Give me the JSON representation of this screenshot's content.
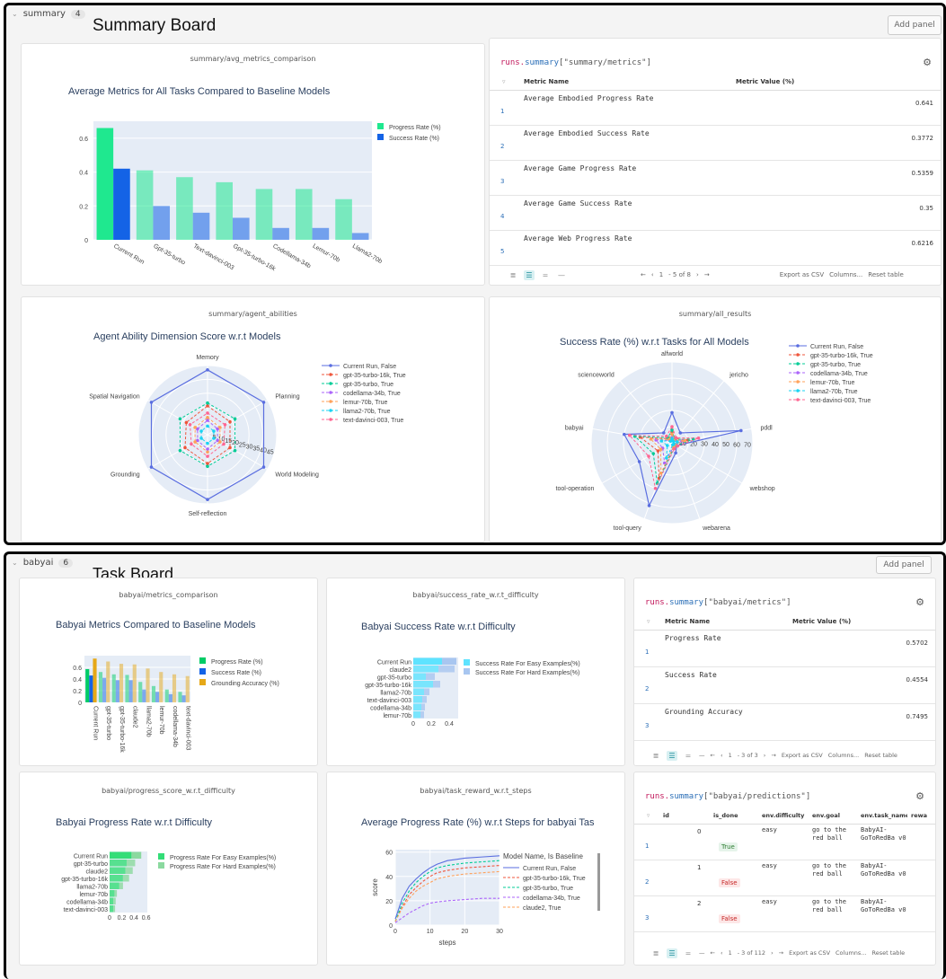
{
  "summary_board": {
    "section_name": "summary",
    "section_count": "4",
    "board_title": "Summary Board",
    "add_panel": "Add panel",
    "avg_panel": {
      "panel_title": "summary/avg_metrics_comparison",
      "chart_title": "Average Metrics for All Tasks Compared to Baseline Models"
    },
    "metrics_table": {
      "code_runs": "runs.",
      "code_summary": "summary",
      "code_key": "[\"summary/metrics\"]",
      "col_metric": "Metric Name",
      "col_value": "Metric Value (%)",
      "rows": [
        {
          "n": "1",
          "name": "Average Embodied Progress Rate",
          "value": "0.641"
        },
        {
          "n": "2",
          "name": "Average Embodied Success Rate",
          "value": "0.3772"
        },
        {
          "n": "3",
          "name": "Average Game Progress Rate",
          "value": "0.5359"
        },
        {
          "n": "4",
          "name": "Average Game Success Rate",
          "value": "0.35"
        },
        {
          "n": "5",
          "name": "Average Web Progress Rate",
          "value": "0.6216"
        }
      ],
      "page_num": "1",
      "page_info": "- 5 of 8",
      "export": "Export as CSV",
      "columns": "Columns...",
      "reset": "Reset table"
    },
    "abilities_panel": {
      "panel_title": "summary/agent_abilities",
      "chart_title": "Agent Ability Dimension Score w.r.t Models"
    },
    "results_panel": {
      "panel_title": "summary/all_results",
      "chart_title": "Success Rate (%) w.r.t Tasks for All Models"
    }
  },
  "task_board": {
    "section_name": "babyai",
    "section_count": "6",
    "board_title": "Task Board",
    "add_panel": "Add panel",
    "metrics_panel": {
      "panel_title": "babyai/metrics_comparison",
      "chart_title": "Babyai Metrics Compared to Baseline Models"
    },
    "success_panel": {
      "panel_title": "babyai/success_rate_w.r.t_difficulty",
      "chart_title": "Babyai Success Rate w.r.t Difficulty"
    },
    "babyai_table": {
      "code_runs": "runs.",
      "code_summary": "summary",
      "code_key": "[\"babyai/metrics\"]",
      "col_metric": "Metric Name",
      "col_value": "Metric Value (%)",
      "rows": [
        {
          "n": "1",
          "name": "Progress Rate",
          "value": "0.5702"
        },
        {
          "n": "2",
          "name": "Success Rate",
          "value": "0.4554"
        },
        {
          "n": "3",
          "name": "Grounding Accuracy",
          "value": "0.7495"
        }
      ],
      "page_num": "1",
      "page_info": "- 3 of 3",
      "export": "Export as CSV",
      "columns": "Columns...",
      "reset": "Reset table"
    },
    "progress_panel": {
      "panel_title": "babyai/progress_score_w.r.t_difficulty",
      "chart_title": "Babyai Progress Rate w.r.t Difficulty"
    },
    "reward_panel": {
      "panel_title": "babyai/task_reward_w.r.t_steps",
      "chart_title": "Average Progress Rate (%) w.r.t Steps for babyai Tas"
    },
    "predictions_table": {
      "code_runs": "runs.",
      "code_summary": "summary",
      "code_key": "[\"babyai/predictions\"]",
      "cols": [
        "id",
        "is_done",
        "env.difficulty",
        "env.goal",
        "env.task_name",
        "rewa"
      ],
      "rows": [
        {
          "n": "1",
          "id": "0",
          "done": "True",
          "diff": "easy",
          "goal": "go to the red ball",
          "task": "BabyAI-GoToRedBa v0"
        },
        {
          "n": "2",
          "id": "1",
          "done": "False",
          "diff": "easy",
          "goal": "go to the red ball",
          "task": "BabyAI-GoToRedBa v0"
        },
        {
          "n": "3",
          "id": "2",
          "done": "False",
          "diff": "easy",
          "goal": "go to the red ball",
          "task": "BabyAI-GoToRedBa v0"
        }
      ],
      "page_num": "1",
      "page_info": "- 3 of 112",
      "export": "Export as CSV",
      "columns": "Columns...",
      "reset": "Reset table"
    }
  },
  "chart_data": [
    {
      "type": "bar",
      "title": "Average Metrics for All Tasks Compared to Baseline Models",
      "categories": [
        "Current Run",
        "Gpt-35-turbo",
        "Text-davinci-003",
        "Gpt-35-turbo-16k",
        "Codellama-34b",
        "Lemur-70b",
        "Llama2-70b"
      ],
      "series": [
        {
          "name": "Progress Rate (%)",
          "values": [
            0.66,
            0.41,
            0.37,
            0.34,
            0.3,
            0.3,
            0.24
          ]
        },
        {
          "name": "Success Rate (%)",
          "values": [
            0.42,
            0.2,
            0.16,
            0.13,
            0.07,
            0.07,
            0.04
          ]
        }
      ],
      "yticks": [
        "0",
        "0.2",
        "0.4",
        "0.6"
      ],
      "ylim": [
        0,
        0.7
      ],
      "colors": [
        "#1fe88f",
        "#1463e6"
      ]
    },
    {
      "type": "radar",
      "title": "Agent Ability Dimension Score w.r.t Models",
      "axes": [
        "Memory",
        "Planning",
        "World Modeling",
        "Self-reflection",
        "Grounding",
        "Spatial Navigation"
      ],
      "radial_ticks": [
        "5",
        "10",
        "15",
        "20",
        "25",
        "30",
        "35",
        "40",
        "45"
      ],
      "rmax": 48,
      "series": [
        {
          "name": "Current Run, False",
          "color": "#5a6ee0",
          "dash": "",
          "values": [
            45,
            45,
            45,
            45,
            45,
            45
          ]
        },
        {
          "name": "gpt-35-turbo-16k, True",
          "color": "#ef553b",
          "dash": "3,2",
          "values": [
            20,
            18,
            18,
            20,
            18,
            17
          ]
        },
        {
          "name": "gpt-35-turbo, True",
          "color": "#00cc96",
          "dash": "3,2",
          "values": [
            22,
            22,
            22,
            22,
            22,
            22
          ]
        },
        {
          "name": "codellama-34b, True",
          "color": "#ab63fa",
          "dash": "3,2",
          "values": [
            10,
            8,
            8,
            10,
            8,
            8
          ]
        },
        {
          "name": "lemur-70b, True",
          "color": "#ffa15a",
          "dash": "3,2",
          "values": [
            12,
            10,
            10,
            12,
            10,
            10
          ]
        },
        {
          "name": "llama2-70b, True",
          "color": "#19d3f3",
          "dash": "3,2",
          "values": [
            6,
            5,
            5,
            6,
            5,
            5
          ]
        },
        {
          "name": "text-davinci-003, True",
          "color": "#ff6692",
          "dash": "3,2",
          "values": [
            15,
            14,
            13,
            15,
            13,
            14
          ]
        }
      ]
    },
    {
      "type": "radar",
      "title": "Success Rate (%) w.r.t Tasks for All Models",
      "axes": [
        "alfworld",
        "jericho",
        "pddl",
        "webshop",
        "webarena",
        "tool-query",
        "tool-operation",
        "babyai",
        "scienceworld"
      ],
      "radial_ticks": [
        "10",
        "20",
        "30",
        "40",
        "50",
        "60",
        "70"
      ],
      "rmax": 75,
      "series": [
        {
          "name": "Current Run, False",
          "color": "#5a6ee0",
          "dash": "",
          "values": [
            28,
            12,
            65,
            5,
            10,
            62,
            35,
            45,
            12
          ]
        },
        {
          "name": "gpt-35-turbo-16k, True",
          "color": "#ef553b",
          "dash": "3,2",
          "values": [
            10,
            5,
            15,
            5,
            5,
            35,
            15,
            30,
            5
          ]
        },
        {
          "name": "gpt-35-turbo, True",
          "color": "#00cc96",
          "dash": "3,2",
          "values": [
            12,
            4,
            20,
            5,
            5,
            40,
            20,
            35,
            6
          ]
        },
        {
          "name": "codellama-34b, True",
          "color": "#ab63fa",
          "dash": "3,2",
          "values": [
            5,
            3,
            10,
            3,
            4,
            20,
            10,
            15,
            3
          ]
        },
        {
          "name": "lemur-70b, True",
          "color": "#ffa15a",
          "dash": "3,2",
          "values": [
            8,
            3,
            12,
            3,
            4,
            30,
            12,
            20,
            4
          ]
        },
        {
          "name": "llama2-70b, True",
          "color": "#19d3f3",
          "dash": "3,2",
          "values": [
            4,
            2,
            5,
            2,
            2,
            15,
            5,
            10,
            2
          ]
        },
        {
          "name": "text-davinci-003, True",
          "color": "#ff6692",
          "dash": "3,2",
          "values": [
            15,
            6,
            25,
            6,
            6,
            45,
            25,
            40,
            8
          ]
        }
      ]
    },
    {
      "type": "bar",
      "title": "Babyai Metrics Compared to Baseline Models",
      "categories": [
        "Current Run",
        "gpt-35-turbo",
        "gpt-35-turbo-16k",
        "claude2",
        "llama2-70b",
        "lemur-70b",
        "codellama-34b",
        "text-davinci-003"
      ],
      "series": [
        {
          "name": "Progress Rate (%)",
          "values": [
            0.57,
            0.52,
            0.48,
            0.47,
            0.35,
            0.28,
            0.22,
            0.18
          ]
        },
        {
          "name": "Success Rate (%)",
          "values": [
            0.46,
            0.42,
            0.38,
            0.38,
            0.22,
            0.18,
            0.14,
            0.12
          ]
        },
        {
          "name": "Grounding Accuracy (%)",
          "values": [
            0.75,
            0.7,
            0.66,
            0.65,
            0.58,
            0.52,
            0.48,
            0.45
          ]
        }
      ],
      "yticks": [
        "0",
        "0.2",
        "0.4",
        "0.6"
      ],
      "ylim": [
        0,
        0.8
      ],
      "colors": [
        "#00cc66",
        "#1463e6",
        "#e6a817"
      ]
    },
    {
      "type": "bar",
      "title": "Babyai Success Rate w.r.t Difficulty",
      "categories": [
        "Current Run",
        "claude2",
        "gpt-35-turbo",
        "gpt-35-turbo-16k",
        "llama2-70b",
        "text-davinci-003",
        "codellama-34b",
        "lemur-70b"
      ],
      "series": [
        {
          "name": "Success Rate For Easy Examples(%)",
          "values": [
            0.32,
            0.28,
            0.14,
            0.22,
            0.12,
            0.1,
            0.09,
            0.08
          ]
        },
        {
          "name": "Success Rate For Hard Examples(%)",
          "values": [
            0.16,
            0.18,
            0.1,
            0.08,
            0.06,
            0.05,
            0.04,
            0.04
          ]
        }
      ],
      "xticks": [
        "0",
        "0.2",
        "0.4"
      ],
      "xlim": [
        0,
        0.5
      ],
      "colors": [
        "#5ee3ff",
        "#a8c6f0"
      ]
    },
    {
      "type": "bar",
      "title": "Babyai Progress Rate w.r.t Difficulty",
      "categories": [
        "Current Run",
        "gpt-35-turbo",
        "claude2",
        "gpt-35-turbo-16k",
        "llama2-70b",
        "lemur-70b",
        "codellama-34b",
        "text-davinci-003"
      ],
      "series": [
        {
          "name": "Progress Rate For Easy Examples(%)",
          "values": [
            0.36,
            0.28,
            0.26,
            0.22,
            0.16,
            0.08,
            0.06,
            0.06
          ]
        },
        {
          "name": "Progress Rate For Hard Examples(%)",
          "values": [
            0.16,
            0.14,
            0.12,
            0.1,
            0.06,
            0.04,
            0.04,
            0.03
          ]
        }
      ],
      "xticks": [
        "0",
        "0.2",
        "0.4",
        "0.6"
      ],
      "xlim": [
        0,
        0.62
      ],
      "colors": [
        "#33dd77",
        "#8bd99f"
      ]
    },
    {
      "type": "line",
      "title": "Average Progress Rate (%) w.r.t Steps for babyai Tas",
      "xlabel": "steps",
      "ylabel": "score",
      "xticks": [
        "0",
        "10",
        "20",
        "30"
      ],
      "yticks": [
        "0",
        "20",
        "40",
        "60"
      ],
      "xlim": [
        0,
        30
      ],
      "ylim": [
        0,
        62
      ],
      "legend_title": "Model Name, Is Baseline",
      "series": [
        {
          "name": "Current Run, False",
          "color": "#5a6ee0",
          "dash": "",
          "x": [
            0,
            2,
            4,
            6,
            8,
            10,
            12,
            15,
            20,
            25,
            30
          ],
          "y": [
            5,
            22,
            32,
            38,
            43,
            47,
            50,
            53,
            55,
            56,
            57
          ]
        },
        {
          "name": "gpt-35-turbo-16k, True",
          "color": "#ef553b",
          "dash": "3,2",
          "x": [
            0,
            2,
            4,
            6,
            8,
            10,
            12,
            15,
            20,
            25,
            30
          ],
          "y": [
            3,
            15,
            25,
            31,
            36,
            40,
            43,
            45,
            47,
            48,
            49
          ]
        },
        {
          "name": "gpt-35-turbo, True",
          "color": "#00cc96",
          "dash": "3,2",
          "x": [
            0,
            2,
            4,
            6,
            8,
            10,
            12,
            15,
            20,
            25,
            30
          ],
          "y": [
            3,
            18,
            28,
            35,
            40,
            44,
            47,
            49,
            51,
            52,
            53
          ]
        },
        {
          "name": "codellama-34b, True",
          "color": "#ab63fa",
          "dash": "3,2",
          "x": [
            0,
            2,
            4,
            6,
            8,
            10,
            12,
            15,
            20,
            25,
            30
          ],
          "y": [
            2,
            6,
            10,
            13,
            16,
            18,
            19,
            20,
            21,
            22,
            22
          ]
        },
        {
          "name": "claude2, True",
          "color": "#ffa15a",
          "dash": "3,2",
          "x": [
            0,
            2,
            4,
            6,
            8,
            10,
            12,
            15,
            20,
            25,
            30
          ],
          "y": [
            3,
            14,
            22,
            28,
            32,
            35,
            38,
            40,
            42,
            43,
            44
          ]
        }
      ]
    }
  ]
}
